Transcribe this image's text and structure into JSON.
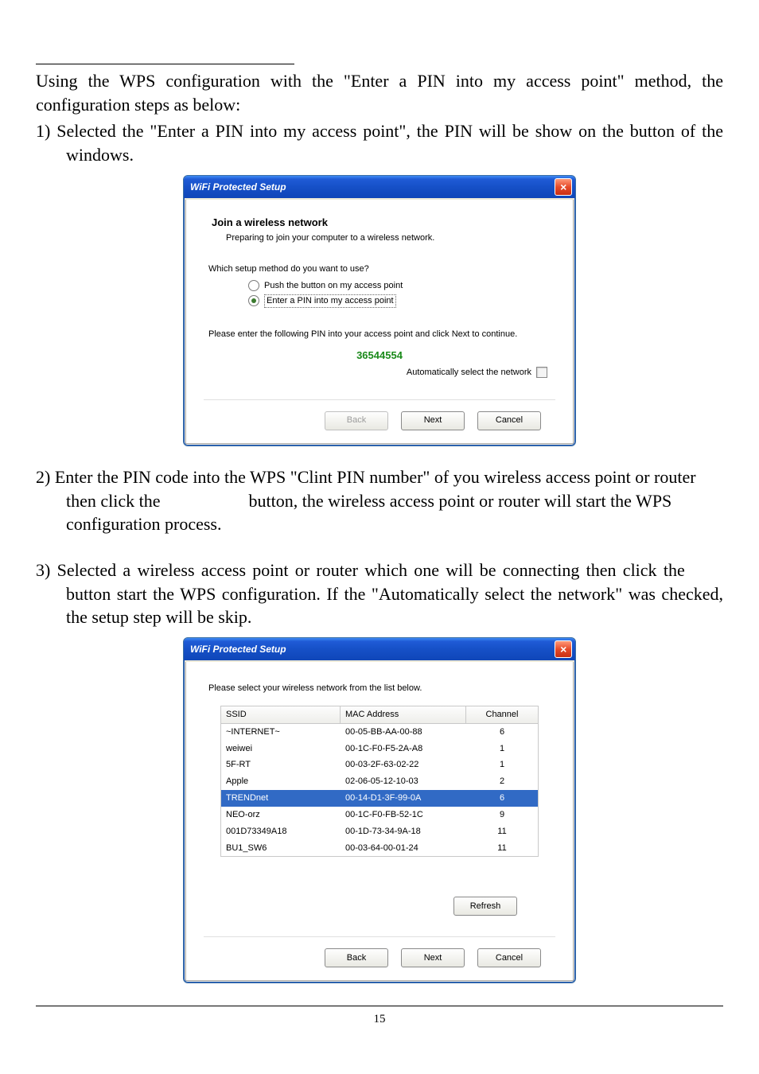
{
  "doc": {
    "intro": "Using the WPS configuration with the \"Enter a PIN into my access point\" method, the configuration steps as below:",
    "step1": "1) Selected the \"Enter a PIN into my access point\", the PIN will be show on the button of the windows.",
    "step2_a": "2) Enter the PIN code into the WPS \"Clint PIN number\" of you wireless access point or router then click the",
    "step2_b": "button, the wireless access point or router will start the WPS configuration process.",
    "step3_a": "3) Selected a wireless access point or router which one will be connecting then click the",
    "step3_b": "button start the WPS configuration. If the \"Automatically select the network\" was checked, the setup step will be skip.",
    "page_number": "15"
  },
  "dlg1": {
    "title": "WiFi Protected Setup",
    "close_glyph": "×",
    "heading": "Join a wireless network",
    "subheading": "Preparing to join your computer to a wireless network.",
    "question": "Which setup method do you want to use?",
    "opt1": "Push the button on my access point",
    "opt2": "Enter a PIN into my access point",
    "instr": "Please enter the following PIN into your access point and click Next to continue.",
    "pin": "36544554",
    "auto_label": "Automatically select the network",
    "back": "Back",
    "next": "Next",
    "cancel": "Cancel"
  },
  "dlg2": {
    "title": "WiFi Protected Setup",
    "close_glyph": "×",
    "instr": "Please select your wireless network from the list below.",
    "col1": "SSID",
    "col2": "MAC Address",
    "col3": "Channel",
    "rows": [
      {
        "ssid": "~INTERNET~",
        "mac": "00-05-BB-AA-00-88",
        "ch": "6",
        "sel": false
      },
      {
        "ssid": "weiwei",
        "mac": "00-1C-F0-F5-2A-A8",
        "ch": "1",
        "sel": false
      },
      {
        "ssid": "5F-RT",
        "mac": "00-03-2F-63-02-22",
        "ch": "1",
        "sel": false
      },
      {
        "ssid": "Apple",
        "mac": "02-06-05-12-10-03",
        "ch": "2",
        "sel": false
      },
      {
        "ssid": "TRENDnet",
        "mac": "00-14-D1-3F-99-0A",
        "ch": "6",
        "sel": true
      },
      {
        "ssid": "NEO-orz",
        "mac": "00-1C-F0-FB-52-1C",
        "ch": "9",
        "sel": false
      },
      {
        "ssid": "001D73349A18",
        "mac": "00-1D-73-34-9A-18",
        "ch": "11",
        "sel": false
      },
      {
        "ssid": "BU1_SW6",
        "mac": "00-03-64-00-01-24",
        "ch": "11",
        "sel": false
      }
    ],
    "refresh": "Refresh",
    "back": "Back",
    "next": "Next",
    "cancel": "Cancel"
  }
}
